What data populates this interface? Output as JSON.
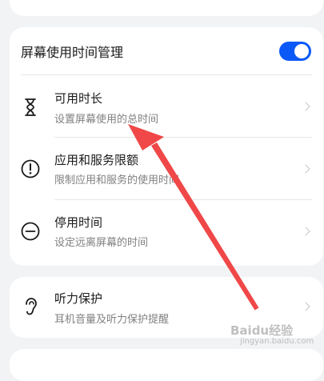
{
  "main_card": {
    "title": "屏幕使用时间管理",
    "toggle_on": true,
    "items": [
      {
        "icon": "hourglass-icon",
        "title": "可用时长",
        "subtitle": "设置屏幕使用的总时间"
      },
      {
        "icon": "alert-circle-icon",
        "title": "应用和服务限额",
        "subtitle": "限制应用和服务的使用时间"
      },
      {
        "icon": "minus-circle-icon",
        "title": "停用时间",
        "subtitle": "设定远离屏幕的时间"
      }
    ]
  },
  "hearing_card": {
    "icon": "ear-icon",
    "title": "听力保护",
    "subtitle": "耳机音量及听力保护提醒"
  },
  "annotation": {
    "arrow_color": "#f04848"
  },
  "watermark": {
    "text": "Baidu经验",
    "sub": "jingyan.baidu.com"
  },
  "colors": {
    "accent": "#0a59f7",
    "background": "#f1f3f5",
    "card": "#ffffff"
  }
}
